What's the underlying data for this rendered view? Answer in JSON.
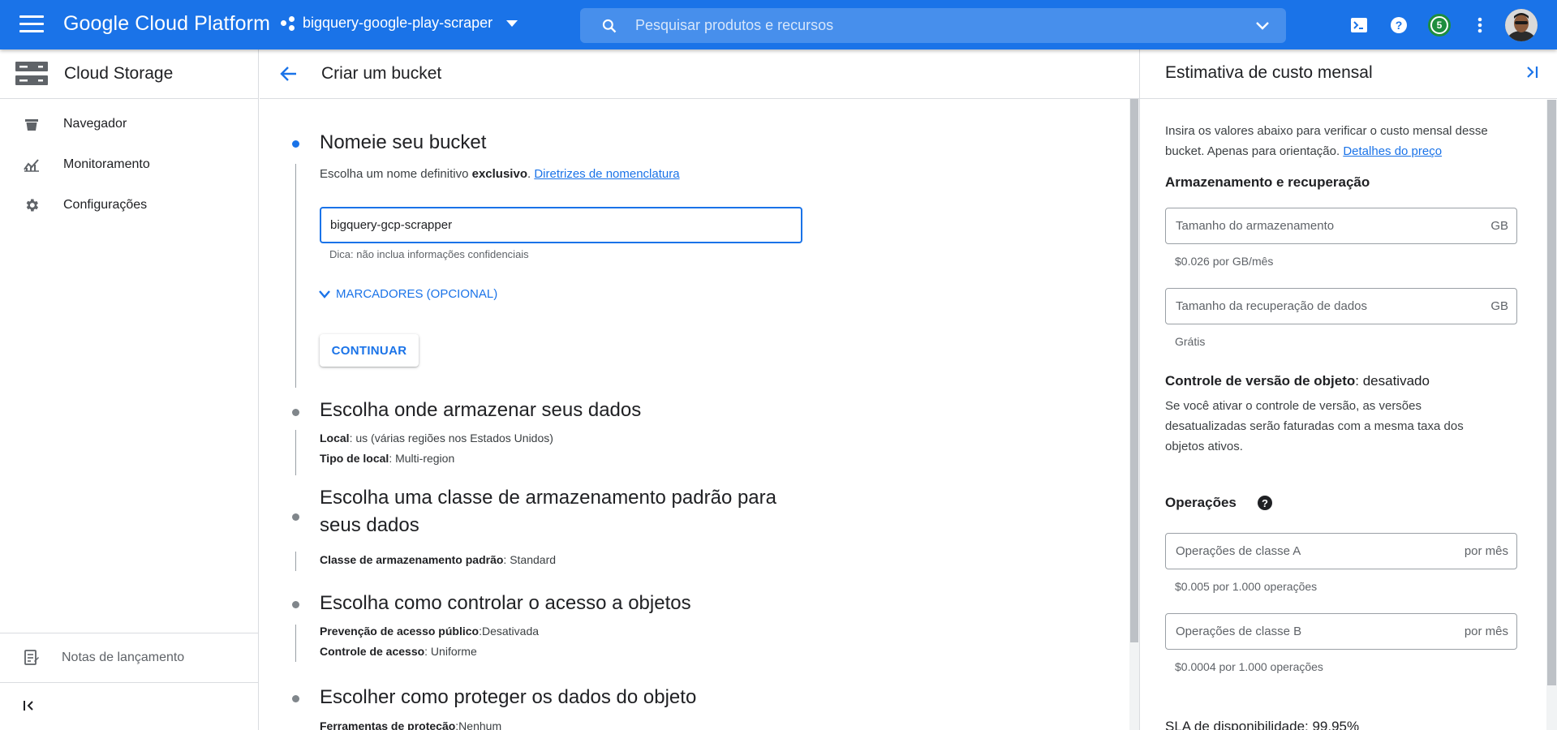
{
  "topbar": {
    "brand": "Google Cloud Platform",
    "project": "bigquery-google-play-scraper",
    "search_placeholder": "Pesquisar produtos e recursos",
    "notification_count": "5",
    "accent": "#1a73e8"
  },
  "leftnav": {
    "title": "Cloud Storage",
    "items": [
      {
        "label": "Navegador",
        "icon": "bucket-icon"
      },
      {
        "label": "Monitoramento",
        "icon": "chart-icon"
      },
      {
        "label": "Configurações",
        "icon": "gear-icon"
      }
    ],
    "release_notes": "Notas de lançamento"
  },
  "main": {
    "title": "Criar um bucket",
    "step1": {
      "title": "Nomeie seu bucket",
      "desc_prefix": "Escolha um nome definitivo ",
      "desc_bold": "exclusivo",
      "desc_suffix": ". ",
      "desc_link": "Diretrizes de nomenclatura",
      "input_value": "bigquery-gcp-scrapper",
      "hint": "Dica: não inclua informações confidenciais",
      "markers": "MARCADORES (OPCIONAL)",
      "continue": "CONTINUAR"
    },
    "step2": {
      "title": "Escolha onde armazenar seus dados",
      "location_label": "Local",
      "location_value": ": us (várias regiões nos Estados Unidos)",
      "type_label": "Tipo de local",
      "type_value": ": Multi-region"
    },
    "step3": {
      "title_line1": "Escolha uma classe de armazenamento padrão para",
      "title_line2": "seus dados",
      "class_label": "Classe de armazenamento padrão",
      "class_value": ": Standard"
    },
    "step4": {
      "title": "Escolha como controlar o acesso a objetos",
      "prevention_label": "Prevenção de acesso público",
      "prevention_value": ":Desativada",
      "control_label": "Controle de acesso",
      "control_value": ": Uniforme"
    },
    "step5": {
      "title": "Escolher como proteger os dados do objeto",
      "tools_label": "Ferramentas de proteção",
      "tools_value": ":Nenhum"
    }
  },
  "cost_panel": {
    "title": "Estimativa de custo mensal",
    "intro_line1": "Insira os valores abaixo para verificar o custo mensal desse",
    "intro_line2": "bucket. Apenas para orientação. ",
    "intro_link": "Detalhes do preço",
    "storage_heading": "Armazenamento e recuperação",
    "storage_size_placeholder": "Tamanho do armazenamento",
    "storage_unit": "GB",
    "storage_price": "$0.026 por GB/mês",
    "retrieval_placeholder": "Tamanho da recuperação de dados",
    "retrieval_unit": "GB",
    "retrieval_price": "Grátis",
    "versioning_label": "Controle de versão de objeto",
    "versioning_value": ": desativado",
    "versioning_line1": "Se você ativar o controle de versão, as versões",
    "versioning_line2": "desatualizadas serão faturadas com a mesma taxa dos",
    "versioning_line3": "objetos ativos.",
    "operations_heading": "Operações",
    "class_a_placeholder": "Operações de classe A",
    "class_a_unit": "por mês",
    "class_a_price": "$0.005 por 1.000 operações",
    "class_b_placeholder": "Operações de classe B",
    "class_b_unit": "por mês",
    "class_b_price": "$0.0004 por 1.000 operações",
    "sla": "SLA de disponibilidade: 99,95%"
  }
}
